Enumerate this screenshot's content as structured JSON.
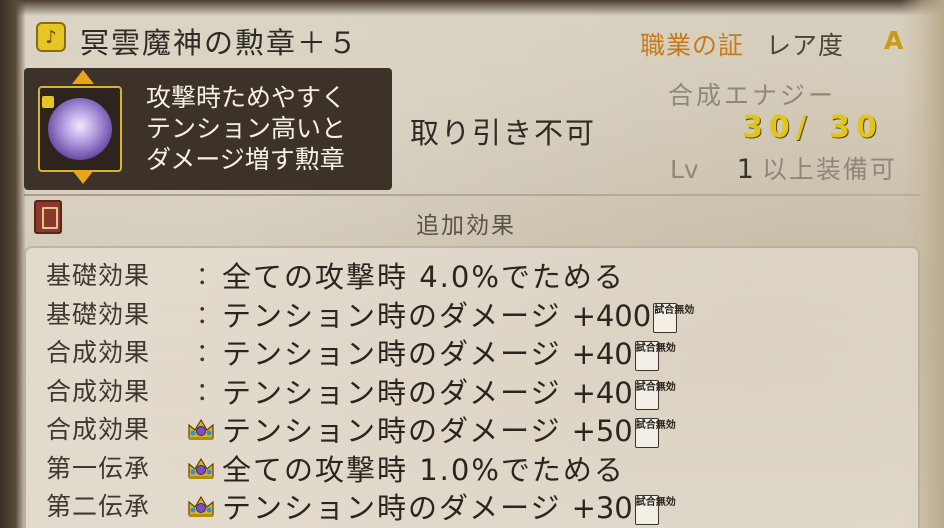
{
  "header": {
    "item_name": "冥雲魔神の勲章＋５",
    "item_icon_glyph": "♪",
    "category": "職業の証",
    "rarity_label": "レア度",
    "rarity_value": "A"
  },
  "description": {
    "lines": [
      "攻撃時ためやすく",
      "テンション高いと",
      "ダメージ増す勲章"
    ]
  },
  "trade_status": "取り引き不可",
  "energy": {
    "label": "合成エナジー",
    "value": "30/ 30"
  },
  "level": {
    "prefix": "Lv",
    "value": "1",
    "suffix": "以上装備可"
  },
  "extra_effects_title": "追加効果",
  "effects": [
    {
      "category": "基礎効果",
      "crown": false,
      "text": "全ての攻撃時 4.0%でためる",
      "value": "",
      "badge": ""
    },
    {
      "category": "基礎効果",
      "crown": false,
      "text": "テンション時のダメージ",
      "value": "+400",
      "badge": "試合無効"
    },
    {
      "category": "合成効果",
      "crown": false,
      "text": "テンション時のダメージ",
      "value": "+40",
      "badge": "試合無効"
    },
    {
      "category": "合成効果",
      "crown": false,
      "text": "テンション時のダメージ",
      "value": "+40",
      "badge": "試合無効"
    },
    {
      "category": "合成効果",
      "crown": true,
      "text": "テンション時のダメージ",
      "value": "+50",
      "badge": "試合無効"
    },
    {
      "category": "第一伝承",
      "crown": true,
      "text": "全ての攻撃時 1.0%でためる",
      "value": "",
      "badge": ""
    },
    {
      "category": "第二伝承",
      "crown": true,
      "text": "テンション時のダメージ",
      "value": "+30",
      "badge": "試合無効"
    }
  ],
  "colors": {
    "category_orange": "#c77a1c",
    "energy_yellow": "#e3c419",
    "panel_dark": "#3d3229"
  },
  "icons": {
    "item": "music-note-badge-icon",
    "emblem": "purple-medal-icon",
    "crown": "crown-icon",
    "book": "book-icon",
    "lock": "lock-icon"
  }
}
